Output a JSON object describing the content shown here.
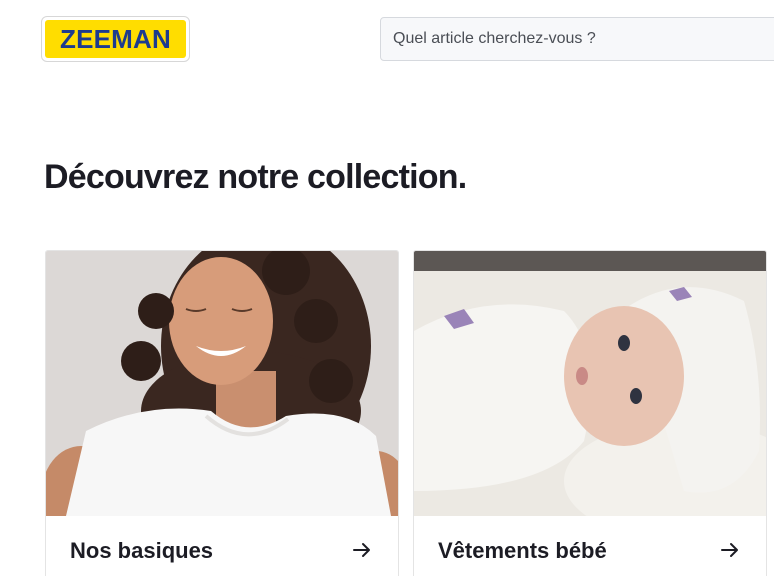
{
  "header": {
    "logo_text": "ZEEMAN",
    "search": {
      "placeholder": "Quel article cherchez-vous ?"
    }
  },
  "main": {
    "title": "Découvrez notre collection.",
    "cards": [
      {
        "label": "Nos basiques",
        "image": "woman-white-tshirt-photo",
        "icon": "arrow-right-icon"
      },
      {
        "label": "Vêtements bébé",
        "image": "baby-hooded-towel-photo",
        "icon": "arrow-right-icon"
      }
    ]
  },
  "colors": {
    "logo_yellow": "#ffdd00",
    "logo_blue": "#1d3b8f",
    "text_dark": "#1c1c24",
    "search_bg": "#f7f8fa"
  }
}
